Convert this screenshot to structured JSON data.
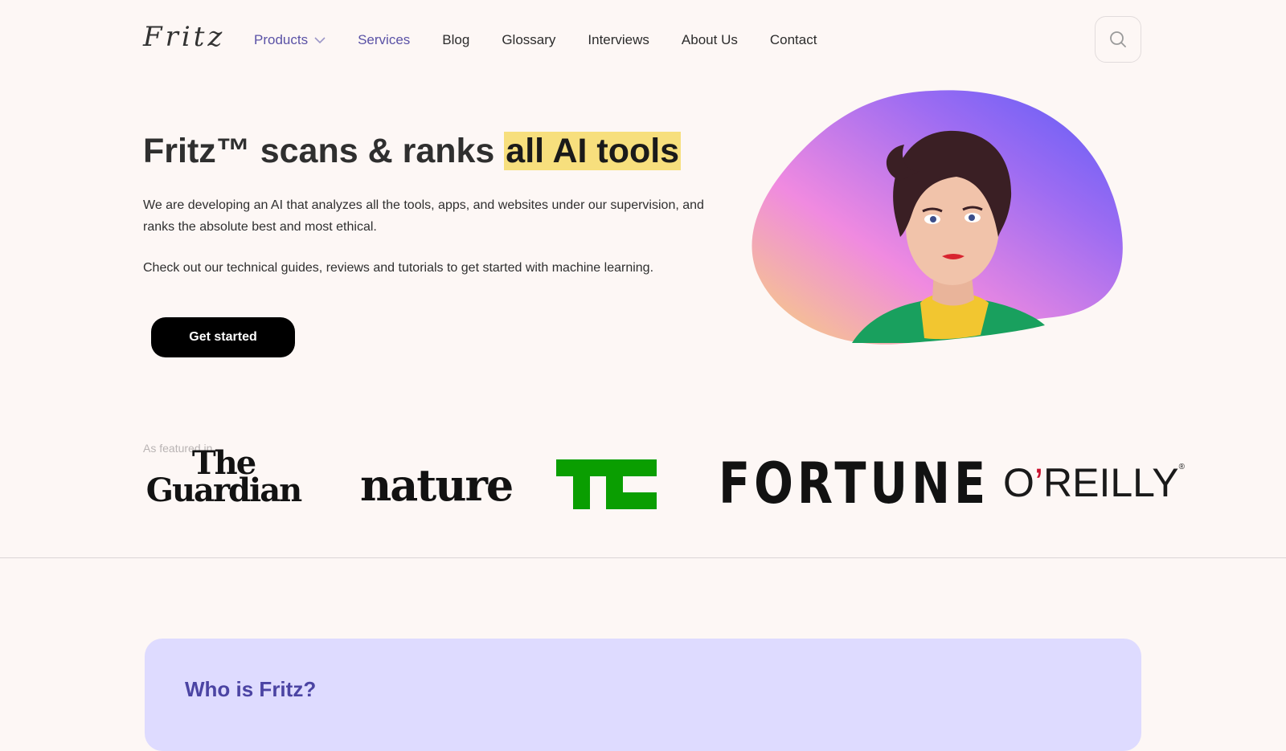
{
  "header": {
    "logo": "Fritz",
    "nav": [
      {
        "label": "Products",
        "has_dropdown": true,
        "accent": true
      },
      {
        "label": "Services",
        "accent": true
      },
      {
        "label": "Blog"
      },
      {
        "label": "Glossary"
      },
      {
        "label": "Interviews"
      },
      {
        "label": "About Us"
      },
      {
        "label": "Contact"
      }
    ],
    "search_icon": "search-icon"
  },
  "hero": {
    "title_prefix": "Fritz™ scans & ranks ",
    "title_highlight": "all AI tools",
    "paragraph_1": "We are developing an AI that analyzes all the tools, apps, and websites under our supervision, and ranks the absolute best and most ethical.",
    "paragraph_2": "Check out our technical guides, reviews and tutorials to get started with machine learning.",
    "cta_label": "Get started",
    "highlight_color": "#f7df7d"
  },
  "featured": {
    "label": "As featured in...",
    "logos": {
      "guardian_line1": "The",
      "guardian_line2": "Guardian",
      "nature": "nature",
      "techcrunch": "TC",
      "fortune": "FORTUNE",
      "oreilly_o": "O",
      "oreilly_apos": "’",
      "oreilly_rest": "REILLY",
      "oreilly_reg": "®"
    }
  },
  "who": {
    "title": "Who is Fritz?"
  },
  "colors": {
    "background": "#fdf7f5",
    "accent": "#5a52a6",
    "card": "#dedbff",
    "techcrunch_green": "#0a9e01"
  }
}
